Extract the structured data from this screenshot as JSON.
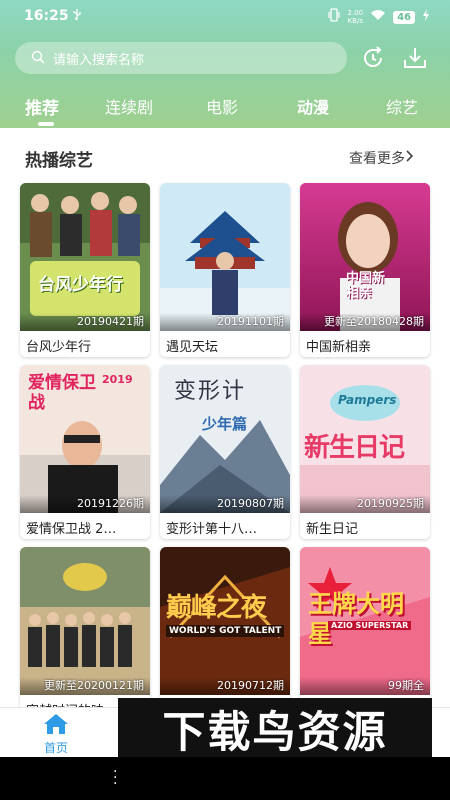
{
  "status_bar": {
    "time": "16:25",
    "usb_icon": "usb-icon",
    "speed_value": "2.00",
    "speed_unit": "KB/s",
    "battery": "46"
  },
  "search": {
    "placeholder": "请输入搜索名称"
  },
  "tabs": [
    {
      "label": "推荐",
      "active": true
    },
    {
      "label": "连续剧"
    },
    {
      "label": "电影"
    },
    {
      "label": "动漫"
    },
    {
      "label": "综艺"
    }
  ],
  "section": {
    "title": "热播综艺",
    "more": "查看更多"
  },
  "cards": [
    {
      "title": "台风少年行",
      "episode": "20190421期",
      "poster_text": "台风少年行"
    },
    {
      "title": "遇见天坛",
      "episode": "20191101期",
      "poster_text": ""
    },
    {
      "title": "中国新相亲",
      "episode": "更新至20180428期",
      "poster_text": "中国新相亲"
    },
    {
      "title": "爱情保卫战 2…",
      "episode": "20191226期",
      "poster_text": "爱情保卫战",
      "poster_year": "2019"
    },
    {
      "title": "变形计第十八…",
      "episode": "20190807期",
      "poster_text": "变形计",
      "poster_sub": "少年篇"
    },
    {
      "title": "新生日记",
      "episode": "20190925期",
      "poster_text": "新生日记",
      "poster_brand": "Pampers"
    },
    {
      "title": "穿越时间的味…",
      "episode": "更新至20200121期",
      "poster_text": ""
    },
    {
      "title": "",
      "episode": "20190712期",
      "poster_text": "巅峰之夜",
      "poster_en": "WORLD'S GOT TALENT"
    },
    {
      "title": "",
      "episode": "99期全",
      "poster_text": "王牌大明星",
      "poster_en": "AZIO SUPERSTAR"
    }
  ],
  "bottom_nav": {
    "home_label": "首页"
  },
  "watermark": {
    "text": "下载鸟资源"
  },
  "colors": {
    "accent": "#2f9be6",
    "header_start": "#8fd8c4",
    "header_end": "#9fd08f"
  }
}
